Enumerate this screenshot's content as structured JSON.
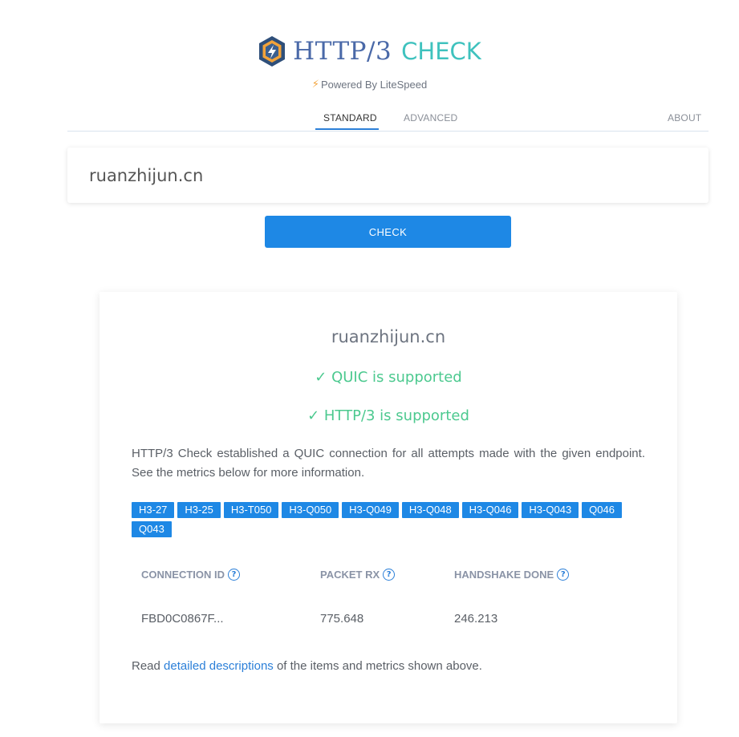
{
  "header": {
    "brand_http": "HTTP/3",
    "brand_check": "CHECK",
    "powered_by": "Powered By LiteSpeed"
  },
  "tabs": [
    {
      "label": "STANDARD",
      "active": true
    },
    {
      "label": "ADVANCED",
      "active": false
    },
    {
      "label": "ABOUT",
      "active": false
    }
  ],
  "search": {
    "value": "ruanzhijun.cn",
    "button_label": "CHECK"
  },
  "result": {
    "domain": "ruanzhijun.cn",
    "quic_status": "✓ QUIC is supported",
    "http3_status": "✓ HTTP/3 is supported",
    "description": "HTTP/3 Check established a QUIC connection for all attempts made with the given endpoint. See the metrics below for more information.",
    "versions": [
      "H3-27",
      "H3-25",
      "H3-T050",
      "H3-Q050",
      "H3-Q049",
      "H3-Q048",
      "H3-Q046",
      "H3-Q043",
      "Q046",
      "Q043"
    ],
    "metrics": {
      "headers": [
        "CONNECTION ID",
        "PACKET RX",
        "HANDSHAKE DONE"
      ],
      "values": [
        "FBD0C0867F...",
        "775.648",
        "246.213"
      ]
    },
    "footer": {
      "prefix": "Read ",
      "link": "detailed descriptions",
      "suffix": " of the items and metrics shown above."
    }
  },
  "colors": {
    "accent": "#1e88e5",
    "brand_http": "#4a69a8",
    "brand_check": "#3fc2be",
    "success": "#4cc98f"
  }
}
